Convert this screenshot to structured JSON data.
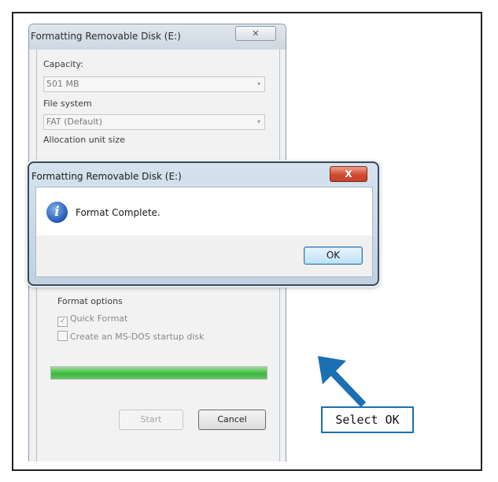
{
  "format_dialog": {
    "title": "Formatting Removable Disk (E:)",
    "close_glyph": "✕",
    "capacity": {
      "label": "Capacity:",
      "value": "501 MB"
    },
    "file_system": {
      "label": "File system",
      "value": "FAT (Default)"
    },
    "allocation": {
      "label": "Allocation unit size"
    },
    "dropdown_arrow": "▾",
    "format_options": {
      "title": "Format options",
      "quick_format": {
        "label": "Quick Format",
        "checked": true,
        "check_glyph": "✓"
      },
      "ms_dos_startup": {
        "label": "Create an MS-DOS startup disk",
        "checked": false
      }
    },
    "progress_percent": 100,
    "start_label": "Start",
    "cancel_label": "Cancel"
  },
  "message_box": {
    "title": "Formatting Removable Disk (E:)",
    "close_glyph": "X",
    "icon": "info-icon",
    "icon_glyph": "i",
    "message": "Format Complete.",
    "ok_label": "OK"
  },
  "annotation": {
    "text": "Select OK",
    "color": "#1b6fb4"
  }
}
